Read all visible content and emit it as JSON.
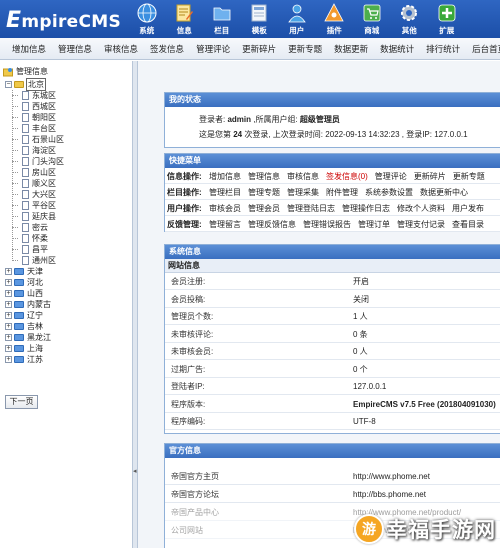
{
  "logo": {
    "prefix": "E",
    "rest": "mpireCMS"
  },
  "topnav": [
    {
      "label": "系统",
      "icon": "globe-icon",
      "color": "#3b8fe0"
    },
    {
      "label": "信息",
      "icon": "pencil-doc-icon",
      "color": "#f4c542"
    },
    {
      "label": "栏目",
      "icon": "folder-icon",
      "color": "#5aa0e8"
    },
    {
      "label": "模板",
      "icon": "template-icon",
      "color": "#e8eef7"
    },
    {
      "label": "用户",
      "icon": "user-icon",
      "color": "#4aa3e6"
    },
    {
      "label": "插件",
      "icon": "plugin-icon",
      "color": "#f29a2e"
    },
    {
      "label": "商城",
      "icon": "cart-icon",
      "color": "#4cae4c"
    },
    {
      "label": "其他",
      "icon": "gear-icon",
      "color": "#9aa8bc"
    },
    {
      "label": "扩展",
      "icon": "plus-icon",
      "color": "#3aa83a"
    }
  ],
  "menubar": [
    "增加信息",
    "管理信息",
    "审核信息",
    "签发信息",
    "管理评论",
    "更新碎片",
    "更新专题",
    "数据更新",
    "数据统计",
    "排行统计",
    "后台首页"
  ],
  "tree": {
    "root": "管理信息",
    "beijing": "北京",
    "beijing_children": [
      "东城区",
      "西城区",
      "朝阳区",
      "丰台区",
      "石景山区",
      "海淀区",
      "门头沟区",
      "房山区",
      "顺义区",
      "大兴区",
      "平谷区",
      "延庆县",
      "密云",
      "怀柔",
      "昌平",
      "通州区"
    ],
    "provinces": [
      "天津",
      "河北",
      "山西",
      "内蒙古",
      "辽宁",
      "吉林",
      "黑龙江",
      "上海",
      "江苏"
    ],
    "next_page": "下一页"
  },
  "status": {
    "title": "我的状态",
    "line1_prefix": "登录者: ",
    "user": "admin",
    "line1_mid": " ,所属用户组: ",
    "group": "超级管理员",
    "line2_prefix": "这是您第 ",
    "login_count": "24",
    "line2_mid": " 次登录, 上次登录时间: 2022-09-13 14:32:23 , 登录IP: 127.0.0.1"
  },
  "quick": {
    "title": "快捷菜单",
    "rows": [
      {
        "cat": "信息操作:",
        "links": [
          "增加信息",
          "管理信息",
          "审核信息",
          "签发信息(0)",
          "管理评论",
          "更新碎片",
          "更新专题"
        ]
      },
      {
        "cat": "栏目操作:",
        "links": [
          "管理栏目",
          "管理专题",
          "管理采集",
          "附件管理",
          "系统参数设置",
          "数据更新中心"
        ]
      },
      {
        "cat": "用户操作:",
        "links": [
          "审核会员",
          "管理会员",
          "管理登陆日志",
          "管理操作日志",
          "修改个人资料",
          "用户发布"
        ]
      },
      {
        "cat": "反馈管理:",
        "links": [
          "管理留言",
          "管理反馈信息",
          "管理错误报告",
          "管理订单",
          "管理支付记录",
          "查看目录"
        ]
      }
    ]
  },
  "sysinfo": {
    "title": "系统信息",
    "subtitle": "网站信息",
    "rows": [
      {
        "k": "会员注册:",
        "v": "开启"
      },
      {
        "k": "会员投稿:",
        "v": "关闭"
      },
      {
        "k": "管理员个数:",
        "v": "1 人"
      },
      {
        "k": "未审核评论:",
        "v": "0 条"
      },
      {
        "k": "未审核会员:",
        "v": "0 人"
      },
      {
        "k": "过期广告:",
        "v": "0 个"
      },
      {
        "k": "登陆者IP:",
        "v": "127.0.0.1"
      },
      {
        "k": "程序版本:",
        "v": "EmpireCMS v7.5 Free (201804091030)"
      },
      {
        "k": "程序编码:",
        "v": "UTF-8"
      }
    ]
  },
  "official": {
    "title": "官方信息",
    "rows": [
      {
        "k": "帝国官方主页",
        "v": "http://www.phome.net"
      },
      {
        "k": "帝国官方论坛",
        "v": "http://bbs.phome.net"
      },
      {
        "k": "帝国产品中心",
        "v": "http://www.phome.net/product/"
      },
      {
        "k": "公司网站",
        "v": "http://www.digod.com"
      }
    ]
  },
  "watermark": {
    "text": "幸福手游网"
  }
}
